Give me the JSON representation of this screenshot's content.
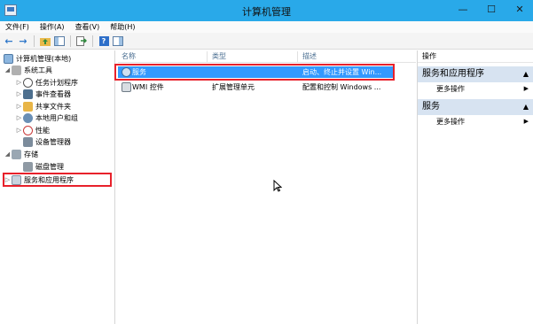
{
  "window": {
    "title": "计算机管理",
    "controls": {
      "minimize": "—",
      "maximize": "☐",
      "close": "✕"
    }
  },
  "menu": [
    "文件(F)",
    "操作(A)",
    "查看(V)",
    "帮助(H)"
  ],
  "toolbar": {
    "back": "←",
    "forward": "→",
    "help": "?"
  },
  "tree": {
    "root": "计算机管理(本地)",
    "system_tools": "系统工具",
    "task_scheduler": "任务计划程序",
    "event_viewer": "事件查看器",
    "shared_folders": "共享文件夹",
    "local_users": "本地用户和组",
    "performance": "性能",
    "device_manager": "设备管理器",
    "storage": "存储",
    "disk_management": "磁盘管理",
    "services_apps": "服务和应用程序"
  },
  "list": {
    "columns": {
      "name": "名称",
      "type": "类型",
      "description": "描述"
    },
    "rows": [
      {
        "name": "服务",
        "type": "",
        "description": "启动、终止并设置 Win..."
      },
      {
        "name": "WMI 控件",
        "type": "扩展管理单元",
        "description": "配置和控制 Windows ..."
      }
    ]
  },
  "actions": {
    "header": "操作",
    "sections": [
      {
        "title": "服务和应用程序",
        "item": "更多操作"
      },
      {
        "title": "服务",
        "item": "更多操作"
      }
    ]
  },
  "colors": {
    "titlebar": "#29a9e9",
    "selection": "#3399ff",
    "highlight_box": "#e8212b",
    "section_bg": "#d7e3f1"
  }
}
